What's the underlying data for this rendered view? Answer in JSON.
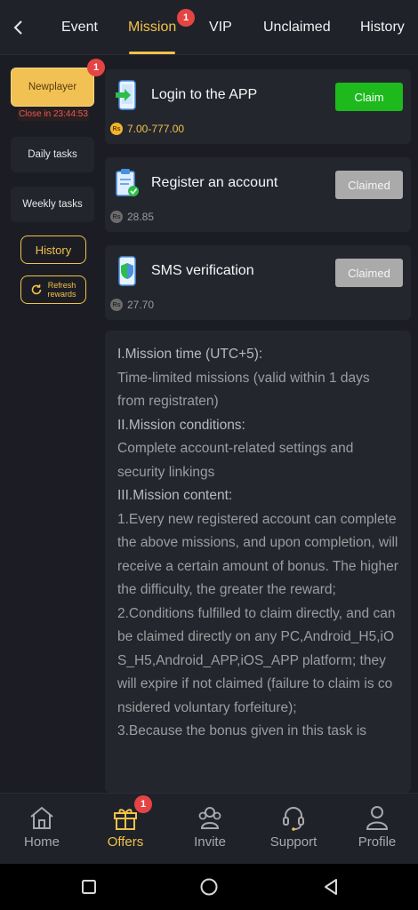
{
  "tabs": [
    {
      "label": "Event"
    },
    {
      "label": "Mission",
      "badge": "1"
    },
    {
      "label": "VIP"
    },
    {
      "label": "Unclaimed"
    },
    {
      "label": "History"
    }
  ],
  "sidebar": {
    "newplayer": {
      "label": "Newplayer",
      "badge": "1",
      "countdown": "Close in 23:44:53"
    },
    "daily": "Daily tasks",
    "weekly": "Weekly tasks",
    "history": "History",
    "refresh_line1": "Refresh",
    "refresh_line2": "rewards"
  },
  "tasks": [
    {
      "title": "Login to the APP",
      "button": "Claim",
      "coin": "Rs",
      "reward": "7.00-777.00",
      "icon": "phone-login-icon"
    },
    {
      "title": "Register an account",
      "button": "Claimed",
      "coin": "Rs",
      "reward": "28.85",
      "icon": "clipboard-check-icon"
    },
    {
      "title": "SMS verification",
      "button": "Claimed",
      "coin": "Rs",
      "reward": "27.70",
      "icon": "shield-phone-icon"
    }
  ],
  "rules": {
    "h1": "I.Mission time (UTC+5):",
    "p1": "Time-limited missions (valid within 1 days from registraten)",
    "h2": "II.Mission conditions:",
    "p2": "Complete account-related settings and security linkings",
    "h3": "III.Mission content:",
    "p3": "1.Every new registered account can complete the above missions, and upon completion, will receive a certain amount of bonus. The higher the difficulty, the greater the reward;",
    "p4": "2.Conditions fulfilled to claim directly, and can be claimed directly on any PC,Android_H5,iOS_H5,Android_APP,iOS_APP platform; they will expire if not claimed (failure to claim is considered voluntary forfeiture);",
    "p5": "3.Because the bonus given in this task is"
  },
  "bottomnav": [
    {
      "label": "Home"
    },
    {
      "label": "Offers",
      "badge": "1"
    },
    {
      "label": "Invite"
    },
    {
      "label": "Support"
    },
    {
      "label": "Profile"
    }
  ],
  "colors": {
    "accent": "#f0c24a",
    "claim": "#1db91d",
    "claimed": "#aaaaaa",
    "badge": "#e44443"
  }
}
